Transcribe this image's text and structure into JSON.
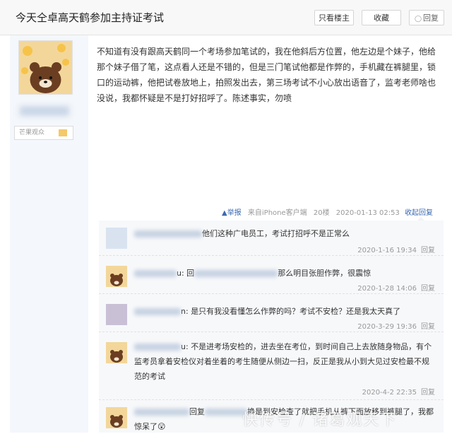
{
  "thread": {
    "title": "今天仝卓高天鹤参加主持证考试",
    "buttons": {
      "only_op": "只看楼主",
      "favorite": "收藏",
      "reply": "回复"
    }
  },
  "op": {
    "badge": "芒果观众",
    "content": "不知道有没有跟高天鹤同一个考场参加笔试的，我在他斜后方位置，他左边是个妹子，他给那个妹子借了笔，这点看人还是不错的，但是三门笔试他都是作弊的，手机藏在裤腿里，锁口的运动裤，他把试卷放地上，拍照发出去，第三场考试不小心放出语音了，监考老师啥也没说，我都怀疑是不是打好招呼了。陈述事实，勿喷",
    "meta": {
      "report": "举报",
      "client": "来自iPhone客户端",
      "floor": "20楼",
      "time": "2020-01-13 02:53",
      "collapse": "收起回复"
    }
  },
  "comments": [
    {
      "pre": "",
      "text": "他们这种广电员工，考试打招呼不是正常么",
      "time": "2020-1-16 19:34",
      "reply": "回复"
    },
    {
      "pre": "u: 回",
      "text": "那么明目张胆作弊，很震惊",
      "time": "2020-1-28 14:06",
      "reply": "回复"
    },
    {
      "pre": "n: ",
      "text": "是只有我没看懂怎么作弊的吗？考试不安检？还是我太天真了",
      "time": "2020-3-29 19:36",
      "reply": "回复"
    },
    {
      "pre": "u: ",
      "text": "不是进考场安检的，进去坐在考位，到时间自己上去放随身物品，有个监考员拿着安检仪对着坐着的考生随便从侧边一扫，反正是我从小到大见过安检最不规范的考试",
      "time": "2020-4-2 22:35",
      "reply": "回复"
    },
    {
      "pre": "回复",
      "text": "换是到安检查了就把手机从裤下面放移到裤腿了，我都惊呆了😲",
      "time": "",
      "reply": ""
    }
  ],
  "watermark": "快传号 / 诸葛观天下"
}
